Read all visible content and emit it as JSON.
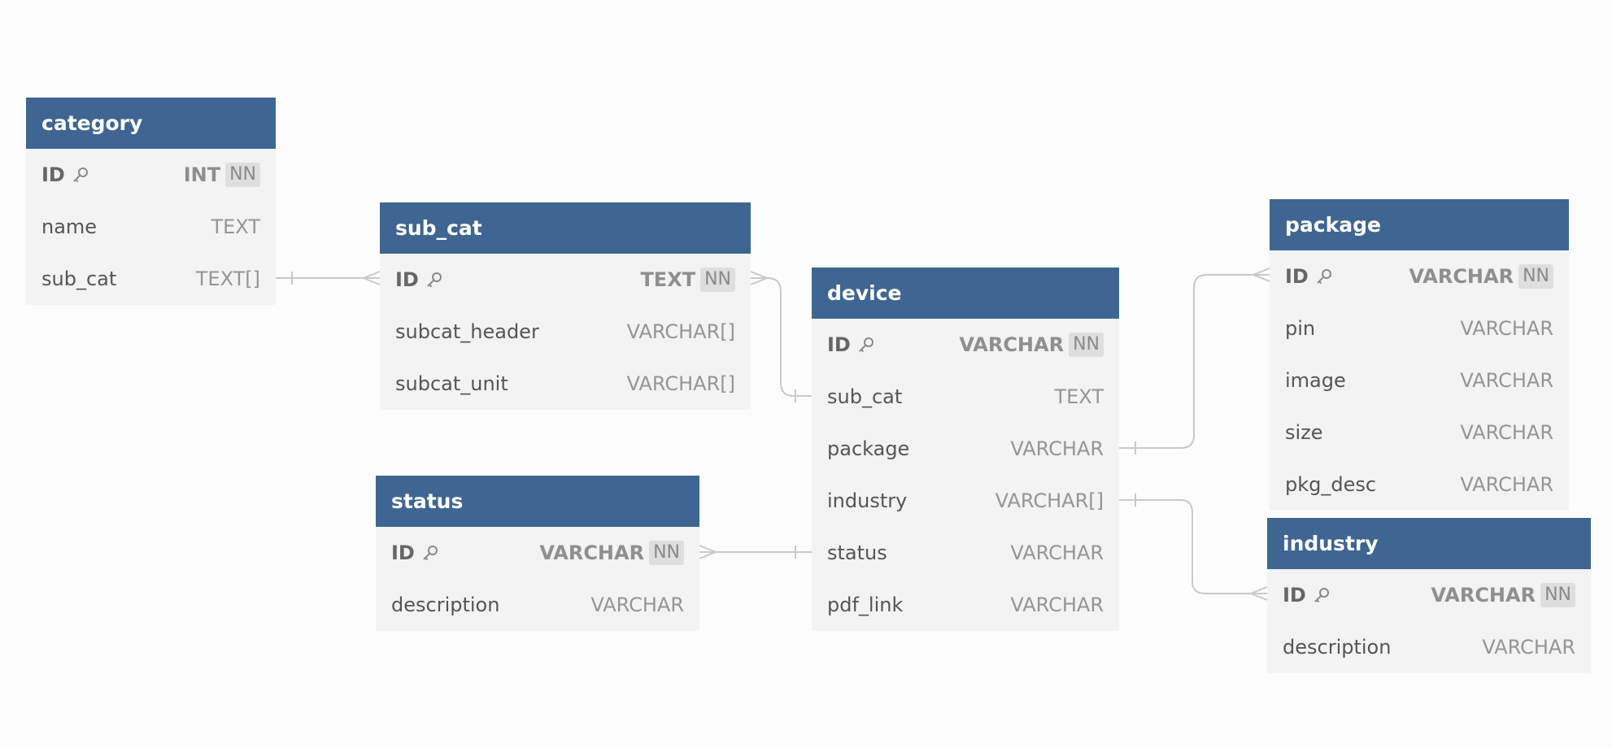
{
  "diagram": {
    "tables": [
      {
        "id": "category",
        "name": "category",
        "columns": [
          {
            "name": "ID",
            "type": "INT",
            "nn": "NN",
            "pk": true
          },
          {
            "name": "name",
            "type": "TEXT"
          },
          {
            "name": "sub_cat",
            "type": "TEXT[]"
          }
        ]
      },
      {
        "id": "sub_cat",
        "name": "sub_cat",
        "columns": [
          {
            "name": "ID",
            "type": "TEXT",
            "nn": "NN",
            "pk": true
          },
          {
            "name": "subcat_header",
            "type": "VARCHAR[]"
          },
          {
            "name": "subcat_unit",
            "type": "VARCHAR[]"
          }
        ]
      },
      {
        "id": "device",
        "name": "device",
        "columns": [
          {
            "name": "ID",
            "type": "VARCHAR",
            "nn": "NN",
            "pk": true
          },
          {
            "name": "sub_cat",
            "type": "TEXT"
          },
          {
            "name": "package",
            "type": "VARCHAR"
          },
          {
            "name": "industry",
            "type": "VARCHAR[]"
          },
          {
            "name": "status",
            "type": "VARCHAR"
          },
          {
            "name": "pdf_link",
            "type": "VARCHAR"
          }
        ]
      },
      {
        "id": "status",
        "name": "status",
        "columns": [
          {
            "name": "ID",
            "type": "VARCHAR",
            "nn": "NN",
            "pk": true
          },
          {
            "name": "description",
            "type": "VARCHAR"
          }
        ]
      },
      {
        "id": "package",
        "name": "package",
        "columns": [
          {
            "name": "ID",
            "type": "VARCHAR",
            "nn": "NN",
            "pk": true
          },
          {
            "name": "pin",
            "type": "VARCHAR"
          },
          {
            "name": "image",
            "type": "VARCHAR"
          },
          {
            "name": "size",
            "type": "VARCHAR"
          },
          {
            "name": "pkg_desc",
            "type": "VARCHAR"
          }
        ]
      },
      {
        "id": "industry",
        "name": "industry",
        "columns": [
          {
            "name": "ID",
            "type": "VARCHAR",
            "nn": "NN",
            "pk": true
          },
          {
            "name": "description",
            "type": "VARCHAR"
          }
        ]
      }
    ],
    "relationships": [
      {
        "from_table": "category",
        "from_column": "sub_cat",
        "to_table": "sub_cat",
        "to_column": "ID",
        "from_end": "one",
        "to_end": "many"
      },
      {
        "from_table": "device",
        "from_column": "sub_cat",
        "to_table": "sub_cat",
        "to_column": "ID",
        "from_end": "one",
        "to_end": "many"
      },
      {
        "from_table": "device",
        "from_column": "package",
        "to_table": "package",
        "to_column": "ID",
        "from_end": "one",
        "to_end": "many"
      },
      {
        "from_table": "device",
        "from_column": "industry",
        "to_table": "industry",
        "to_column": "ID",
        "from_end": "one",
        "to_end": "many"
      },
      {
        "from_table": "device",
        "from_column": "status",
        "to_table": "status",
        "to_column": "ID",
        "from_end": "one",
        "to_end": "many"
      }
    ],
    "colors": {
      "header_bg": "#3f6692",
      "header_text": "#ffffff",
      "table_body": "#f3f3f3",
      "canvas_bg": "#fcfcfc",
      "connector": "#c9c9c9",
      "nn_badge_bg": "#dedede"
    },
    "icons": {
      "primary_key": "key-icon"
    }
  }
}
